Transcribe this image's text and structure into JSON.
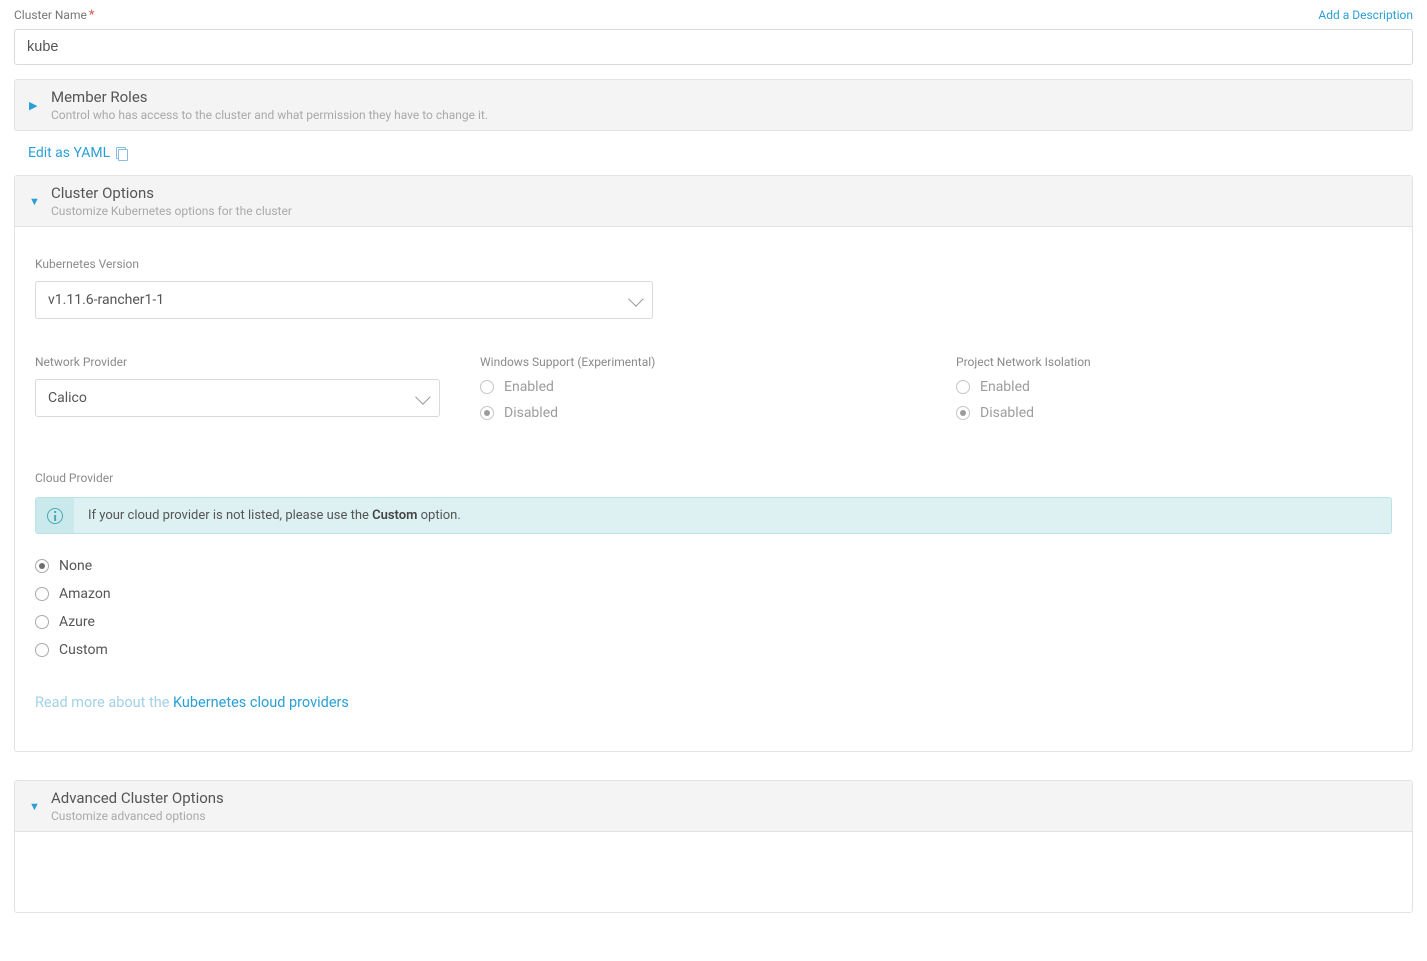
{
  "clusterName": {
    "label": "Cluster Name",
    "value": "kube",
    "addDescription": "Add a Description"
  },
  "memberRoles": {
    "title": "Member Roles",
    "subtitle": "Control who has access to the cluster and what permission they have to change it."
  },
  "editYaml": "Edit as YAML",
  "clusterOptions": {
    "title": "Cluster Options",
    "subtitle": "Customize Kubernetes options for the cluster",
    "k8sVersion": {
      "label": "Kubernetes Version",
      "value": "v1.11.6-rancher1-1"
    },
    "networkProvider": {
      "label": "Network Provider",
      "value": "Calico"
    },
    "windowsSupport": {
      "label": "Windows Support (Experimental)",
      "enabled": "Enabled",
      "disabled": "Disabled",
      "value": "disabled"
    },
    "projectIsolation": {
      "label": "Project Network Isolation",
      "enabled": "Enabled",
      "disabled": "Disabled",
      "value": "disabled"
    },
    "cloudProvider": {
      "label": "Cloud Provider",
      "infoPrefix": "If your cloud provider is not listed, please use the ",
      "infoBold": "Custom",
      "infoSuffix": " option.",
      "options": {
        "none": "None",
        "amazon": "Amazon",
        "azure": "Azure",
        "custom": "Custom"
      },
      "value": "none",
      "readMorePrefix": "Read more about the ",
      "readMoreLink": "Kubernetes cloud providers"
    }
  },
  "advanced": {
    "title": "Advanced Cluster Options",
    "subtitle": "Customize advanced options"
  }
}
